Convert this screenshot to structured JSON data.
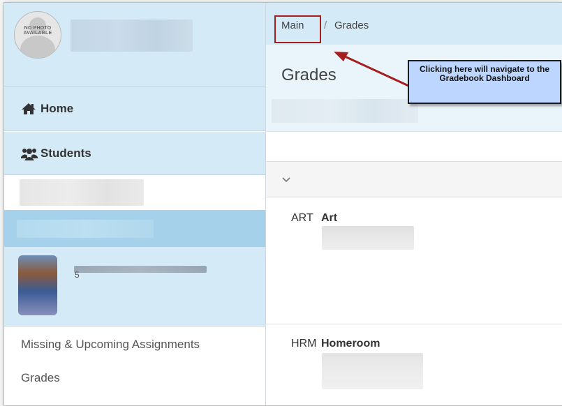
{
  "profile": {
    "avatar_text": "NO PHOTO AVAILABLE"
  },
  "sidebar": {
    "home_label": "Home",
    "students_label": "Students",
    "student_card_count": "5",
    "links": [
      "Missing & Upcoming Assignments",
      "Grades"
    ]
  },
  "breadcrumb": {
    "main": "Main",
    "separator": "/",
    "current": "Grades"
  },
  "page": {
    "title": "Grades"
  },
  "callout": {
    "text": "Clicking here will navigate to the Gradebook Dashboard"
  },
  "courses": [
    {
      "code": "ART",
      "name": "Art"
    },
    {
      "code": "HRM",
      "name": "Homeroom"
    }
  ],
  "colors": {
    "highlight_box": "#a51d1d",
    "arrow": "#a51d1d",
    "callout_bg": "#bcd6ff",
    "nav_bg": "#d4ebf7"
  },
  "icons": {
    "home": "home-icon",
    "students": "students-icon",
    "expand": "chevron-down-icon"
  }
}
